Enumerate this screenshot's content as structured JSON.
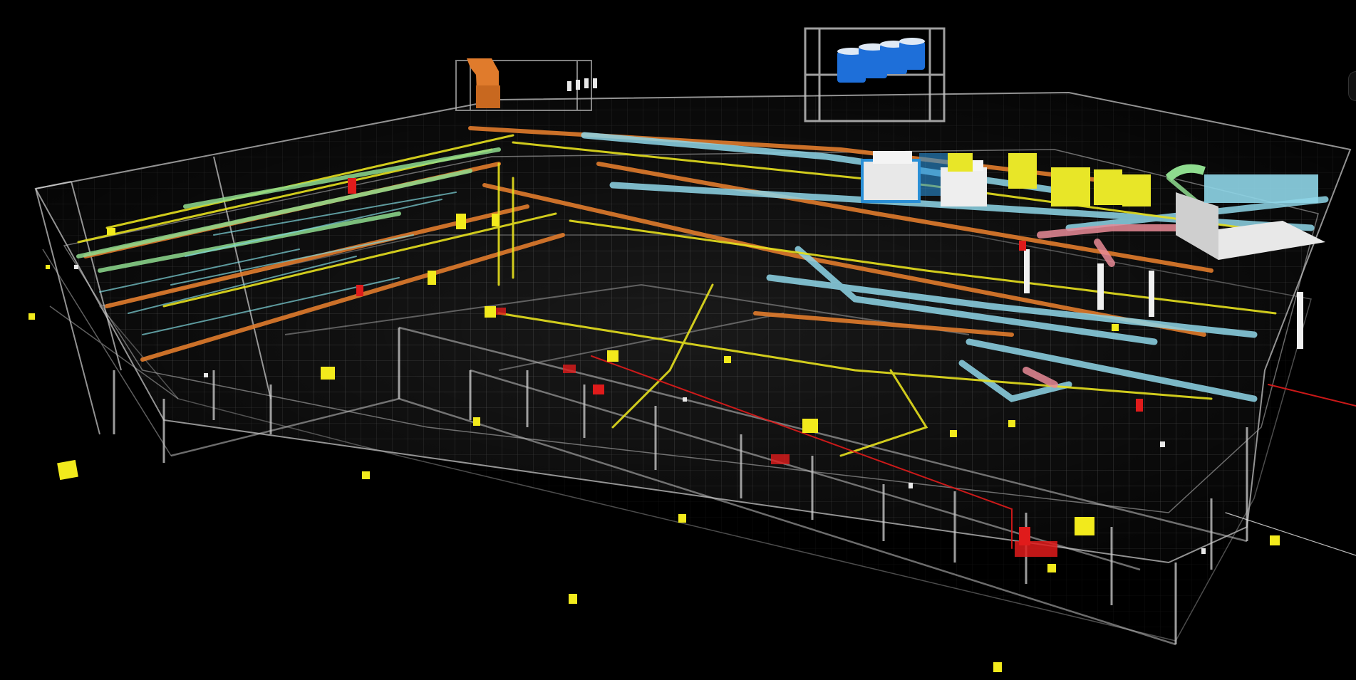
{
  "scene": {
    "background": "#000000",
    "subject": "bim-mep-model-3d-wireframe",
    "colors": {
      "structure": "#cfcfcf",
      "hvac_duct": "#7fd6dc",
      "chilled_water": "#8fd6e8",
      "hot_pipe": "#e07b2c",
      "electrical": "#e6e01e",
      "fire_protection": "#e01b1b",
      "supply_air": "#e88a96",
      "return_air": "#8fdc8f",
      "equipment_white": "#e8e8e8",
      "tanks": "#1e6fd9",
      "exhaust_stack": "#e07b2c"
    },
    "icons": [
      "cooling-tank-icon",
      "chiller-unit-icon",
      "exhaust-stack-icon",
      "ahu-icon",
      "junction-box-icon",
      "fire-pump-icon"
    ]
  }
}
